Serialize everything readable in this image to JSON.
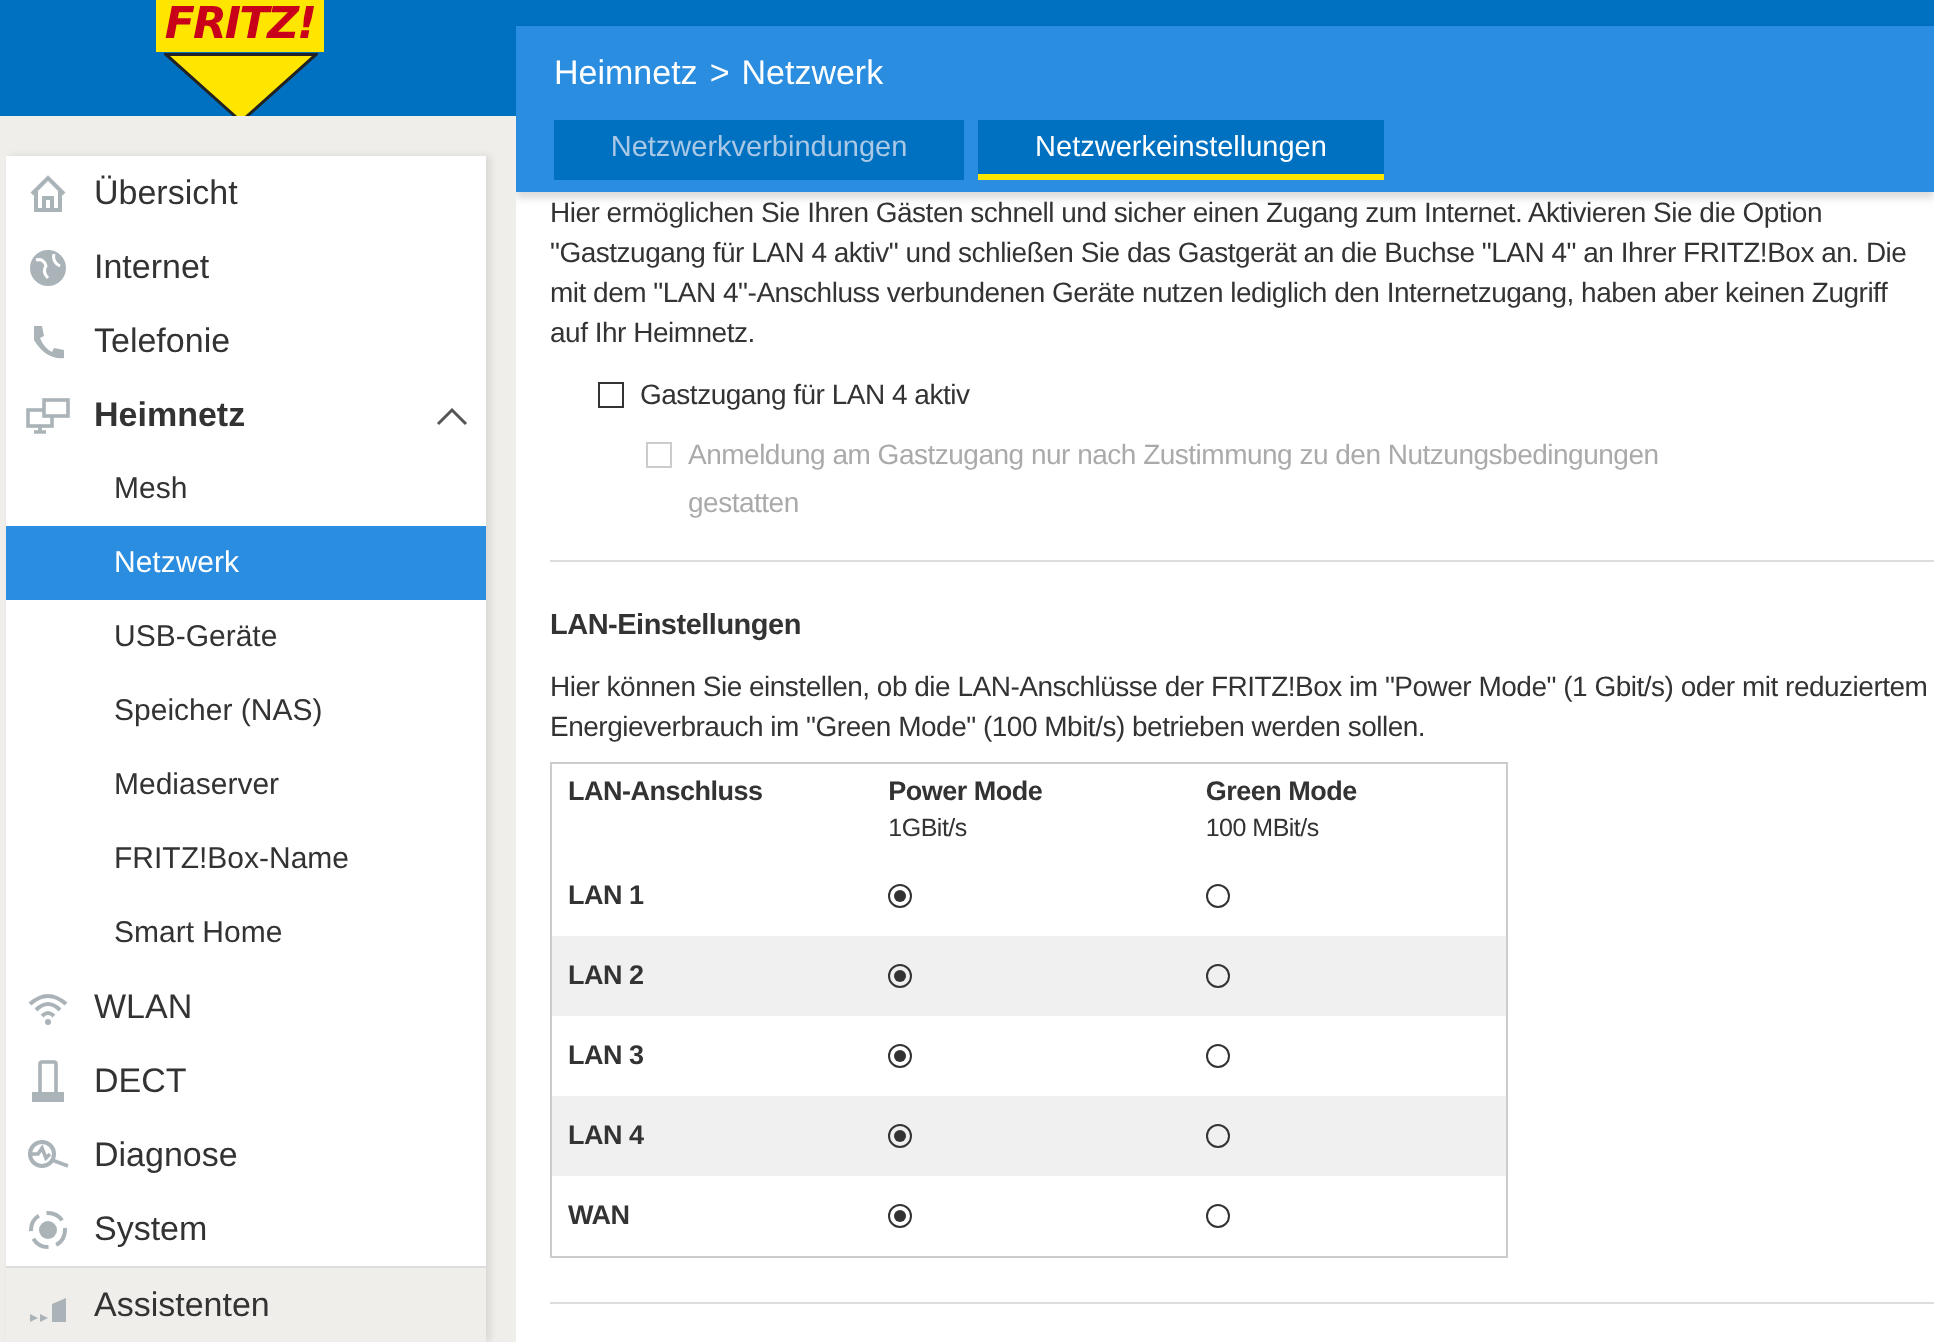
{
  "logo": {
    "text": "FRITZ!"
  },
  "breadcrumb": {
    "parent": "Heimnetz",
    "separator": ">",
    "current": "Netzwerk"
  },
  "tabs": [
    {
      "label": "Netzwerkverbindungen",
      "selected": false
    },
    {
      "label": "Netzwerkeinstellungen",
      "selected": true
    }
  ],
  "sidebar": {
    "items": [
      {
        "label": "Übersicht",
        "selected": false
      },
      {
        "label": "Internet",
        "selected": false
      },
      {
        "label": "Telefonie",
        "selected": false
      },
      {
        "label": "Heimnetz",
        "selected": false,
        "expanded": true,
        "children": [
          {
            "label": "Mesh",
            "selected": false
          },
          {
            "label": "Netzwerk",
            "selected": true
          },
          {
            "label": "USB-Geräte",
            "selected": false
          },
          {
            "label": "Speicher (NAS)",
            "selected": false
          },
          {
            "label": "Mediaserver",
            "selected": false
          },
          {
            "label": "FRITZ!Box-Name",
            "selected": false
          },
          {
            "label": "Smart Home",
            "selected": false
          }
        ]
      },
      {
        "label": "WLAN",
        "selected": false
      },
      {
        "label": "DECT",
        "selected": false
      },
      {
        "label": "Diagnose",
        "selected": false
      },
      {
        "label": "System",
        "selected": false
      }
    ],
    "footer_item": {
      "label": "Assistenten"
    }
  },
  "guest": {
    "description": "Hier ermöglichen Sie Ihren Gästen schnell und sicher einen Zugang zum Internet. Aktivieren Sie die Option \"Gastzugang für LAN 4 aktiv\" und schließen Sie das Gastgerät an die Buchse \"LAN 4\" an Ihrer FRITZ!Box an. Die mit dem \"LAN 4\"-Anschluss verbundenen Geräte nutzen lediglich den Internetzugang, haben aber keinen Zugriff auf Ihr Heimnetz.",
    "options": [
      {
        "label": "Gastzugang für LAN 4 aktiv",
        "checked": false,
        "disabled": false
      },
      {
        "label": "Anmeldung am Gastzugang nur nach Zustimmung zu den Nutzungsbedingungen gestatten",
        "checked": false,
        "disabled": true
      }
    ]
  },
  "lan": {
    "title": "LAN-Einstellungen",
    "description": "Hier können Sie einstellen, ob die LAN-Anschlüsse der FRITZ!Box im \"Power Mode\" (1 Gbit/s) oder mit reduziertem Energieverbrauch im \"Green Mode\" (100 Mbit/s) betrieben werden sollen.",
    "columns": [
      {
        "label": "LAN-Anschluss"
      },
      {
        "label": "Power Mode",
        "sub": "1GBit/s"
      },
      {
        "label": "Green Mode",
        "sub": "100 MBit/s"
      }
    ],
    "rows": [
      {
        "port": "LAN 1",
        "modes": [
          {
            "selected": true
          },
          {
            "selected": false
          }
        ]
      },
      {
        "port": "LAN 2",
        "modes": [
          {
            "selected": true
          },
          {
            "selected": false
          }
        ]
      },
      {
        "port": "LAN 3",
        "modes": [
          {
            "selected": true
          },
          {
            "selected": false
          }
        ]
      },
      {
        "port": "LAN 4",
        "modes": [
          {
            "selected": true
          },
          {
            "selected": false
          }
        ]
      },
      {
        "port": "WAN",
        "modes": [
          {
            "selected": true
          },
          {
            "selected": false
          }
        ]
      }
    ]
  }
}
